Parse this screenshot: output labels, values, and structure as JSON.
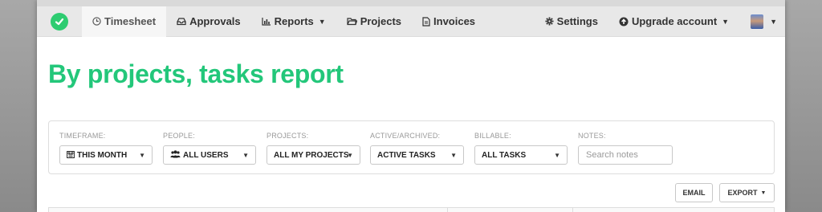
{
  "colors": {
    "brand": "#2ecc71",
    "title": "#23c77a",
    "navbar": "#e8e8e8"
  },
  "navbar": {
    "logo_icon": "stopwatch-check-icon",
    "items": [
      {
        "label": "Timesheet",
        "icon": "clock-icon",
        "active": true
      },
      {
        "label": "Approvals",
        "icon": "inbox-icon"
      },
      {
        "label": "Reports",
        "icon": "bar-chart-icon",
        "dropdown": true
      },
      {
        "label": "Projects",
        "icon": "folder-icon"
      },
      {
        "label": "Invoices",
        "icon": "document-icon"
      }
    ],
    "right": [
      {
        "label": "Settings",
        "icon": "gear-icon"
      },
      {
        "label": "Upgrade account",
        "icon": "upload-circle-icon",
        "dropdown": true
      }
    ],
    "user_avatar": "user-avatar"
  },
  "page": {
    "title": "By projects, tasks report"
  },
  "filters": {
    "timeframe": {
      "label": "TIMEFRAME:",
      "value": "THIS MONTH",
      "icon": "calendar-icon"
    },
    "people": {
      "label": "PEOPLE:",
      "value": "ALL USERS",
      "icon": "users-icon"
    },
    "projects": {
      "label": "PROJECTS:",
      "value": "ALL MY PROJECTS"
    },
    "active_archived": {
      "label": "ACTIVE/ARCHIVED:",
      "value": "ACTIVE TASKS"
    },
    "billable": {
      "label": "BILLABLE:",
      "value": "ALL TASKS"
    },
    "notes": {
      "label": "NOTES:",
      "placeholder": "Search notes"
    }
  },
  "actions": {
    "email_label": "EMAIL",
    "export_label": "EXPORT"
  }
}
